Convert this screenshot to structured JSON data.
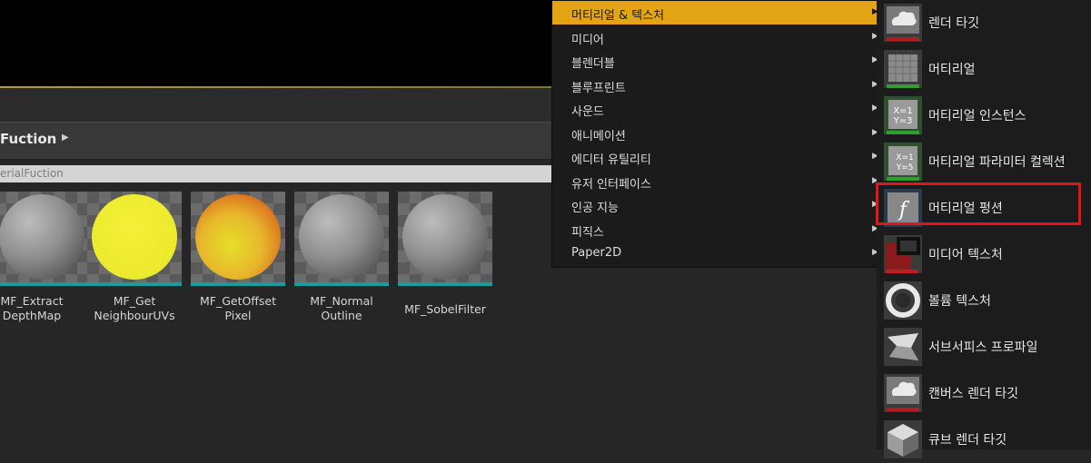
{
  "folder": {
    "title": "Fuction",
    "path": "erialFuction"
  },
  "assets": [
    {
      "line1": "MF_Extract",
      "line2": "DepthMap",
      "sphere": "grey"
    },
    {
      "line1": "MF_Get",
      "line2": "NeighbourUVs",
      "sphere": "yellow"
    },
    {
      "line1": "MF_GetOffset",
      "line2": "Pixel",
      "sphere": "orange"
    },
    {
      "line1": "MF_Normal",
      "line2": "Outline",
      "sphere": "grey"
    },
    {
      "line1": "MF_SobelFilter",
      "line2": "",
      "sphere": "grey"
    }
  ],
  "category_menu": [
    "머티리얼 & 텍스처",
    "미디어",
    "블렌더블",
    "블루프린트",
    "사운드",
    "애니메이션",
    "에디터 유틸리티",
    "유저 인터페이스",
    "인공 지능",
    "피직스",
    "Paper2D"
  ],
  "category_menu_active": 0,
  "asset_menu": [
    {
      "label": "렌더 타깃",
      "icon": "render-target-icon"
    },
    {
      "label": "머티리얼",
      "icon": "material-icon"
    },
    {
      "label": "머티리얼 인스턴스",
      "icon": "material-instance-icon"
    },
    {
      "label": "머티리얼 파라미터 컬렉션",
      "icon": "material-parameter-collection-icon"
    },
    {
      "label": "머티리얼 펑션",
      "icon": "material-function-icon"
    },
    {
      "label": "미디어 텍스처",
      "icon": "media-texture-icon"
    },
    {
      "label": "볼륨 텍스처",
      "icon": "volume-texture-icon"
    },
    {
      "label": "서브서피스 프로파일",
      "icon": "subsurface-profile-icon"
    },
    {
      "label": "캔버스 렌더 타깃",
      "icon": "canvas-render-target-icon"
    },
    {
      "label": "큐브 렌더 타깃",
      "icon": "cube-render-target-icon"
    }
  ],
  "highlighted_item": "머티리얼 펑션",
  "colors": {
    "menu_active": "#e3a513",
    "highlight": "#e4141a",
    "thumb_underline": "#1b9aa0"
  }
}
